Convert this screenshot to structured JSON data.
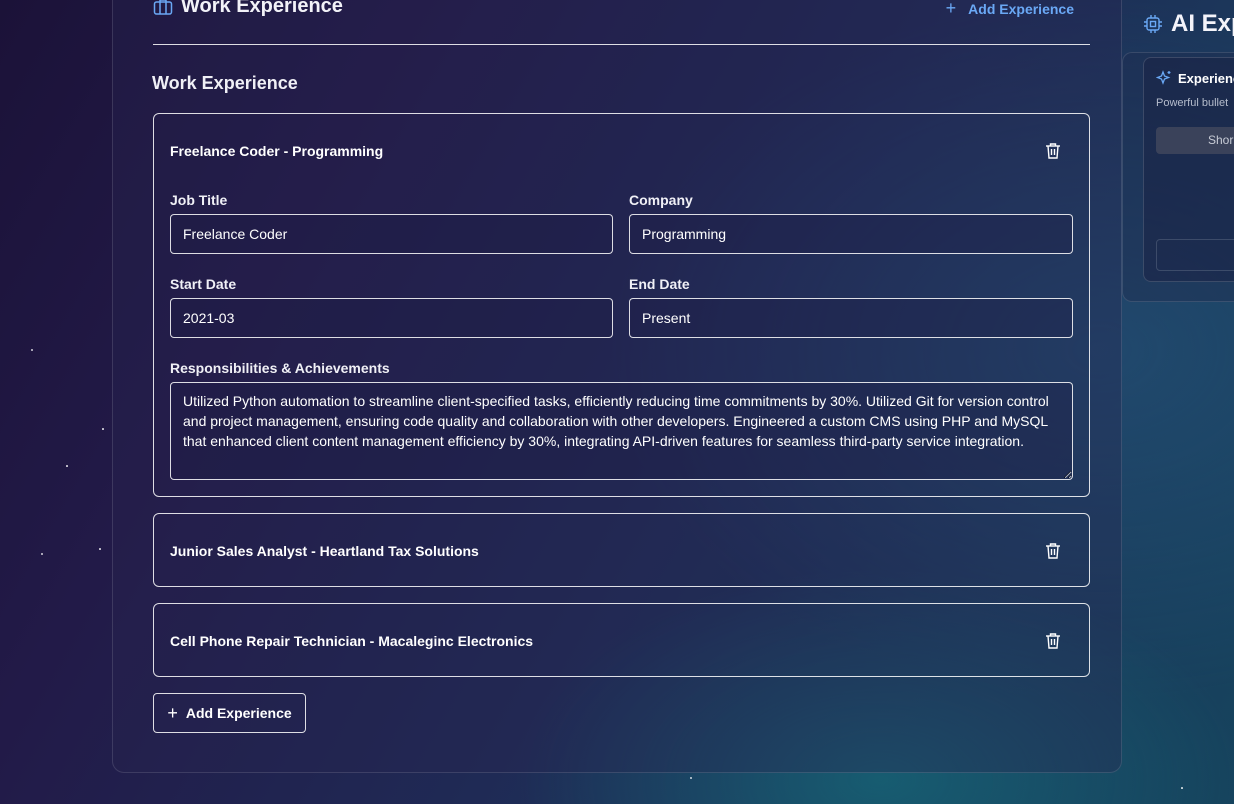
{
  "section": {
    "icon": "briefcase-icon",
    "title": "Work Experience",
    "add_link": "Add Experience"
  },
  "subheading": "Work Experience",
  "experiences": [
    {
      "header": "Freelance Coder - Programming",
      "expanded": true,
      "job_title_label": "Job Title",
      "job_title": "Freelance Coder",
      "company_label": "Company",
      "company": "Programming",
      "start_date_label": "Start Date",
      "start_date": "2021-03",
      "end_date_label": "End Date",
      "end_date": "Present",
      "responsibilities_label": "Responsibilities & Achievements",
      "responsibilities": "Utilized Python automation to streamline client-specified tasks, efficiently reducing time commitments by 30%. Utilized Git for version control and project management, ensuring code quality and collaboration with other developers. Engineered a custom CMS using PHP and MySQL that enhanced client content management efficiency by 30%, integrating API-driven features for seamless third-party service integration."
    },
    {
      "header": "Junior Sales Analyst - Heartland Tax Solutions",
      "expanded": false
    },
    {
      "header": "Cell Phone Repair Technician - Macaleginc Electronics",
      "expanded": false
    }
  ],
  "add_button": "Add Experience",
  "ai_panel": {
    "icon": "chip-icon",
    "title": "AI Exp",
    "card_icon": "sparkle-icon",
    "card_title": "Experience",
    "card_desc": "Powerful bullet",
    "option_label": "Shor"
  },
  "colors": {
    "accent_link": "#6aa8f5",
    "border": "#ffffff",
    "background_start": "#1b1238",
    "background_end": "#16435d"
  }
}
